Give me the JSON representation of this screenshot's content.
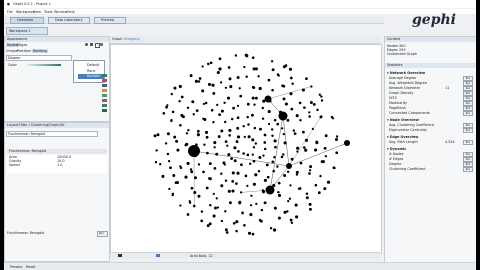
{
  "window": {
    "title": "Gephi 0.9.2 - Project 1"
  },
  "menu": [
    "File",
    "Workspace",
    "View",
    "Tools",
    "Window",
    "Help"
  ],
  "modes": [
    "Overview",
    "Data Laboratory",
    "Preview"
  ],
  "workspace_tab": "Workspace 1",
  "left_panel": {
    "tabs": [
      "Appearance",
      "Layout"
    ],
    "subtabs": [
      "Nodes",
      "Edges"
    ],
    "buttons": [
      "Unique",
      "Partition",
      "Ranking"
    ],
    "attribute": "Degree",
    "color_label": "Color",
    "dropdown": {
      "options": [
        "Default",
        "Rank",
        "Ranked"
      ],
      "selected": "Ranked"
    }
  },
  "layout_panel": {
    "tabs": [
      "Layout",
      "Filter / Clustering/Graph/Sc"
    ],
    "algorithm": "Fruchterman Reingold",
    "header": "Fruchterman Reingold",
    "props": [
      {
        "k": "Area",
        "v": "10000.0"
      },
      {
        "k": "Gravity",
        "v": "10.0"
      },
      {
        "k": "Speed",
        "v": "1.0"
      }
    ],
    "footer": "Fruchterman Reingold",
    "run": "Run"
  },
  "graph": {
    "tab": "Graph",
    "toolbar": "Dragging"
  },
  "bottombar": {
    "font": "Arial Bold, 12"
  },
  "right_panel": {
    "tabs": [
      "Context",
      "Statistics"
    ],
    "context": [
      {
        "k": "Nodes:",
        "v": "300"
      },
      {
        "k": "Edges:",
        "v": "299"
      },
      {
        "k": "Undirected Graph",
        "v": ""
      }
    ],
    "sections": [
      {
        "title": "Network Overview",
        "items": [
          "Average Degree",
          "Avg. Weighted Degree",
          "Network Diameter",
          "Graph Density",
          "HITS",
          "Modularity",
          "PageRank",
          "Connected Components"
        ],
        "values": [
          "",
          "",
          "11",
          "",
          "",
          "",
          "",
          ""
        ]
      },
      {
        "title": "Node Overview",
        "items": [
          "Avg. Clustering Coefficient",
          "Eigenvector Centrality"
        ],
        "values": [
          "",
          ""
        ]
      },
      {
        "title": "Edge Overview",
        "items": [
          "Avg. Path Length"
        ],
        "values": [
          "4.524"
        ]
      },
      {
        "title": "Dynamic",
        "items": [
          "# Nodes",
          "# Edges",
          "Degree",
          "Clustering Coefficient"
        ],
        "values": [
          "",
          "",
          "",
          ""
        ]
      }
    ],
    "run_label": "Run"
  },
  "status": {
    "presets": "Presets",
    "reset": "Reset"
  },
  "logo": "gephi",
  "colors": {
    "accent": "#3f80c6",
    "hub": "#000000"
  }
}
